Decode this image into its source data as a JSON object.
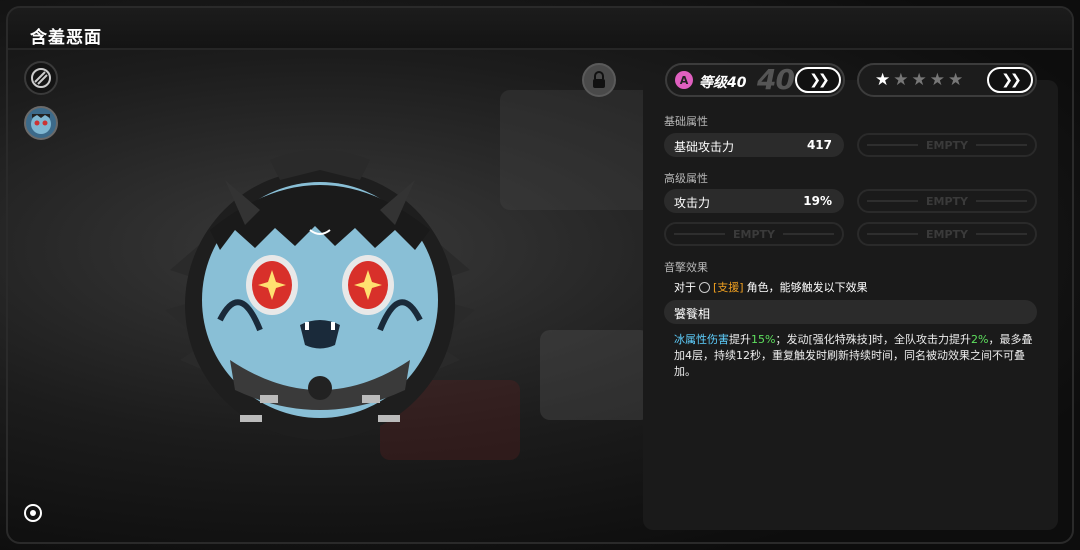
{
  "title": "含羞恶面",
  "level": {
    "label": "等级40",
    "big": "40",
    "icon_letter": "A"
  },
  "stars": {
    "filled": 1,
    "total": 5
  },
  "sections": {
    "base_label": "基础属性",
    "advanced_label": "高级属性",
    "effect_label": "音擎效果"
  },
  "base_stats": [
    {
      "name": "基础攻击力",
      "value": "417"
    }
  ],
  "advanced_stats": [
    {
      "name": "攻击力",
      "value": "19%"
    }
  ],
  "empty_label": "EMPTY",
  "effect": {
    "prefix": "对于",
    "tag": "[支援]",
    "suffix": "角色，能够触发以下效果",
    "name": "饕餮相",
    "desc_parts": {
      "p1": "冰属性伤害",
      "p2": "提升",
      "p3": "15%",
      "p4": "；发动[强化特殊技]时，全队攻击力提升",
      "p5": "2%",
      "p6": "，最多叠加4层，持续12秒，重复触发时刷新持续时间，同名被动效果之间不可叠加。"
    }
  },
  "icons": {
    "weapon": "w-engine-icon",
    "avatar": "bangboo-avatar-icon",
    "lock": "lock-icon",
    "info": "info-icon",
    "arrow": "double-chevron-icon"
  },
  "arrows": "❯❯"
}
